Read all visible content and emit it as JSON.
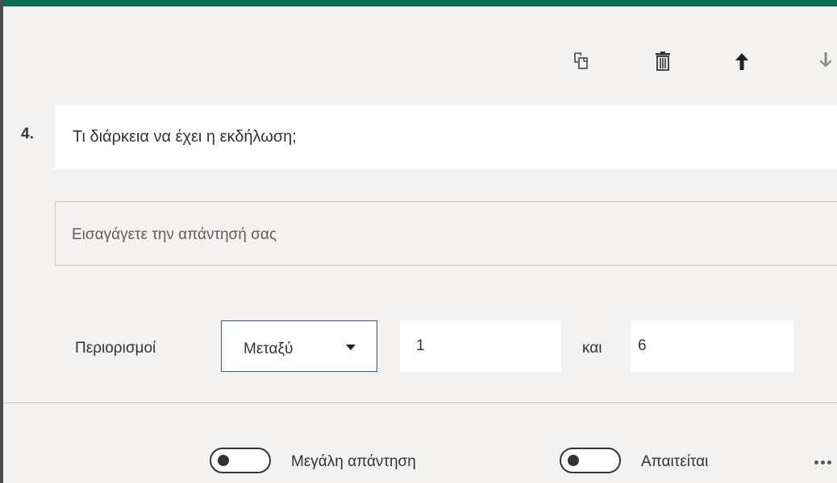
{
  "toolbar": {
    "copy_icon": "copy-icon",
    "delete_icon": "trash-icon",
    "move_up_icon": "arrow-up-icon",
    "move_down_icon": "arrow-down-icon"
  },
  "question": {
    "number": "4.",
    "title": "Τι διάρκεια να έχει η εκδήλωση;"
  },
  "answer": {
    "placeholder": "Εισαγάγετε την απάντησή σας"
  },
  "restrictions": {
    "label": "Περιορισμοί",
    "selected": "Μεταξύ",
    "min_value": "1",
    "and_label": "και",
    "max_value": "6"
  },
  "footer": {
    "long_answer_label": "Μεγάλη απάντηση",
    "long_answer_on": false,
    "required_label": "Απαιτείται",
    "required_on": false,
    "more_icon": "more-horizontal-icon"
  },
  "colors": {
    "accent": "#0a6e57",
    "dropdown_border": "#2b5797",
    "background": "#f3f2f1"
  }
}
